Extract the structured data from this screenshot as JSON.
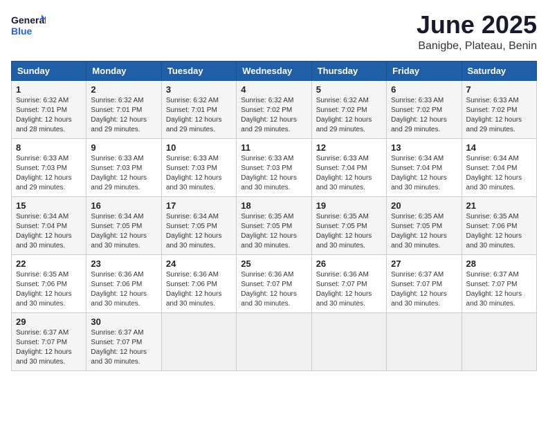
{
  "logo": {
    "line1": "General",
    "line2": "Blue"
  },
  "title": "June 2025",
  "location": "Banigbe, Plateau, Benin",
  "days_of_week": [
    "Sunday",
    "Monday",
    "Tuesday",
    "Wednesday",
    "Thursday",
    "Friday",
    "Saturday"
  ],
  "weeks": [
    [
      {
        "day": "1",
        "sunrise": "6:32 AM",
        "sunset": "7:01 PM",
        "daylight": "12 hours and 28 minutes."
      },
      {
        "day": "2",
        "sunrise": "6:32 AM",
        "sunset": "7:01 PM",
        "daylight": "12 hours and 29 minutes."
      },
      {
        "day": "3",
        "sunrise": "6:32 AM",
        "sunset": "7:01 PM",
        "daylight": "12 hours and 29 minutes."
      },
      {
        "day": "4",
        "sunrise": "6:32 AM",
        "sunset": "7:02 PM",
        "daylight": "12 hours and 29 minutes."
      },
      {
        "day": "5",
        "sunrise": "6:32 AM",
        "sunset": "7:02 PM",
        "daylight": "12 hours and 29 minutes."
      },
      {
        "day": "6",
        "sunrise": "6:33 AM",
        "sunset": "7:02 PM",
        "daylight": "12 hours and 29 minutes."
      },
      {
        "day": "7",
        "sunrise": "6:33 AM",
        "sunset": "7:02 PM",
        "daylight": "12 hours and 29 minutes."
      }
    ],
    [
      {
        "day": "8",
        "sunrise": "6:33 AM",
        "sunset": "7:03 PM",
        "daylight": "12 hours and 29 minutes."
      },
      {
        "day": "9",
        "sunrise": "6:33 AM",
        "sunset": "7:03 PM",
        "daylight": "12 hours and 29 minutes."
      },
      {
        "day": "10",
        "sunrise": "6:33 AM",
        "sunset": "7:03 PM",
        "daylight": "12 hours and 30 minutes."
      },
      {
        "day": "11",
        "sunrise": "6:33 AM",
        "sunset": "7:03 PM",
        "daylight": "12 hours and 30 minutes."
      },
      {
        "day": "12",
        "sunrise": "6:33 AM",
        "sunset": "7:04 PM",
        "daylight": "12 hours and 30 minutes."
      },
      {
        "day": "13",
        "sunrise": "6:34 AM",
        "sunset": "7:04 PM",
        "daylight": "12 hours and 30 minutes."
      },
      {
        "day": "14",
        "sunrise": "6:34 AM",
        "sunset": "7:04 PM",
        "daylight": "12 hours and 30 minutes."
      }
    ],
    [
      {
        "day": "15",
        "sunrise": "6:34 AM",
        "sunset": "7:04 PM",
        "daylight": "12 hours and 30 minutes."
      },
      {
        "day": "16",
        "sunrise": "6:34 AM",
        "sunset": "7:05 PM",
        "daylight": "12 hours and 30 minutes."
      },
      {
        "day": "17",
        "sunrise": "6:34 AM",
        "sunset": "7:05 PM",
        "daylight": "12 hours and 30 minutes."
      },
      {
        "day": "18",
        "sunrise": "6:35 AM",
        "sunset": "7:05 PM",
        "daylight": "12 hours and 30 minutes."
      },
      {
        "day": "19",
        "sunrise": "6:35 AM",
        "sunset": "7:05 PM",
        "daylight": "12 hours and 30 minutes."
      },
      {
        "day": "20",
        "sunrise": "6:35 AM",
        "sunset": "7:05 PM",
        "daylight": "12 hours and 30 minutes."
      },
      {
        "day": "21",
        "sunrise": "6:35 AM",
        "sunset": "7:06 PM",
        "daylight": "12 hours and 30 minutes."
      }
    ],
    [
      {
        "day": "22",
        "sunrise": "6:35 AM",
        "sunset": "7:06 PM",
        "daylight": "12 hours and 30 minutes."
      },
      {
        "day": "23",
        "sunrise": "6:36 AM",
        "sunset": "7:06 PM",
        "daylight": "12 hours and 30 minutes."
      },
      {
        "day": "24",
        "sunrise": "6:36 AM",
        "sunset": "7:06 PM",
        "daylight": "12 hours and 30 minutes."
      },
      {
        "day": "25",
        "sunrise": "6:36 AM",
        "sunset": "7:07 PM",
        "daylight": "12 hours and 30 minutes."
      },
      {
        "day": "26",
        "sunrise": "6:36 AM",
        "sunset": "7:07 PM",
        "daylight": "12 hours and 30 minutes."
      },
      {
        "day": "27",
        "sunrise": "6:37 AM",
        "sunset": "7:07 PM",
        "daylight": "12 hours and 30 minutes."
      },
      {
        "day": "28",
        "sunrise": "6:37 AM",
        "sunset": "7:07 PM",
        "daylight": "12 hours and 30 minutes."
      }
    ],
    [
      {
        "day": "29",
        "sunrise": "6:37 AM",
        "sunset": "7:07 PM",
        "daylight": "12 hours and 30 minutes."
      },
      {
        "day": "30",
        "sunrise": "6:37 AM",
        "sunset": "7:07 PM",
        "daylight": "12 hours and 30 minutes."
      },
      null,
      null,
      null,
      null,
      null
    ]
  ],
  "labels": {
    "sunrise": "Sunrise:",
    "sunset": "Sunset:",
    "daylight": "Daylight:"
  }
}
